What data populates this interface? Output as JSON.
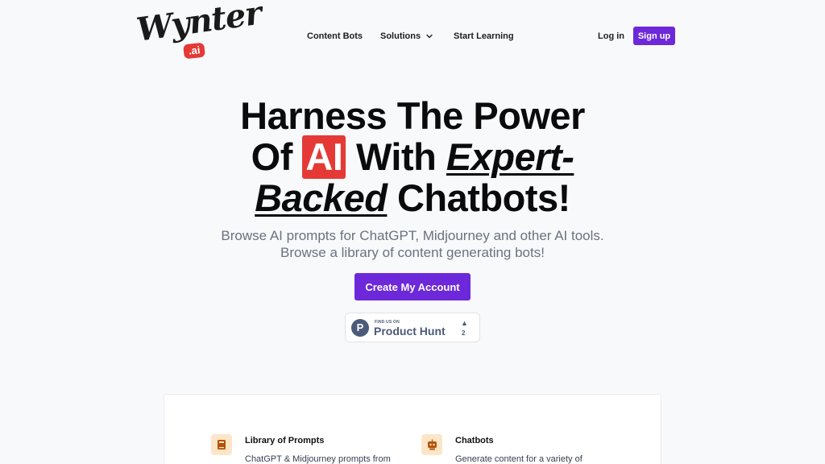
{
  "brand": {
    "name": "Wynter",
    "suffix": ".ai",
    "accent": "#6d28d9",
    "highlight": "#e53935"
  },
  "nav": {
    "items": [
      {
        "label": "Content Bots"
      },
      {
        "label": "Solutions",
        "icon": "chevron-down-icon"
      },
      {
        "label": "Start Learning"
      }
    ],
    "login_label": "Log in",
    "signup_label": "Sign up"
  },
  "hero": {
    "title_line1": "Harness The Power",
    "title_of": "Of",
    "title_ai": "AI",
    "title_with": "With",
    "title_expert": "Expert-",
    "title_backed": "Backed",
    "title_chatbots": "Chatbots!",
    "subtitle": "Browse AI prompts for ChatGPT, Midjourney and other AI tools. Browse a library of content generating bots!",
    "cta_label": "Create My Account"
  },
  "product_hunt": {
    "small_text": "FIND US ON",
    "name": "Product Hunt",
    "logo_letter": "P",
    "arrow": "▲",
    "count": "2"
  },
  "features": [
    {
      "title": "Library of Prompts",
      "description": "ChatGPT & Midjourney prompts from",
      "icon": "book-icon"
    },
    {
      "title": "Chatbots",
      "description": "Generate content for a variety of",
      "icon": "robot-icon"
    }
  ]
}
